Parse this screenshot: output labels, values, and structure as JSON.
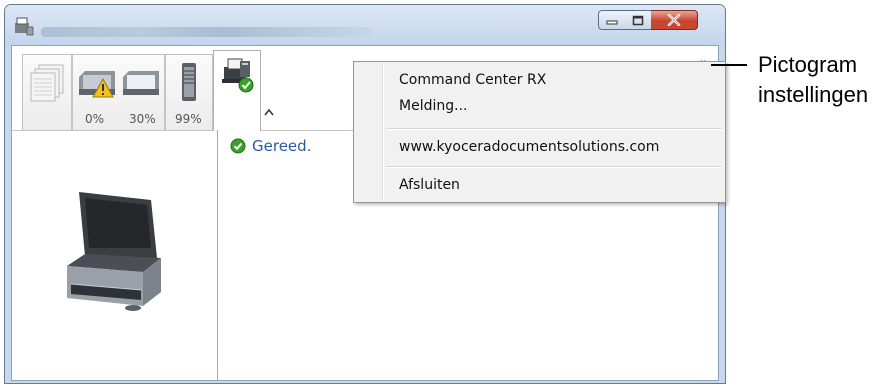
{
  "window": {
    "title_text": "",
    "controls": {
      "minimize": "minimize",
      "maximize": "maximize",
      "close": "close"
    }
  },
  "tabs": [
    {
      "id": "pages",
      "label": "",
      "icon": "pages-stack-icon"
    },
    {
      "id": "tray1",
      "label": "0%",
      "icon": "paper-tray-warning-icon"
    },
    {
      "id": "tray2",
      "label": "30%",
      "icon": "paper-tray-icon"
    },
    {
      "id": "toner",
      "label": "99%",
      "icon": "toner-cartridge-icon"
    },
    {
      "id": "status",
      "label": "",
      "icon": "printer-ok-icon",
      "active": true
    }
  ],
  "status": {
    "text": "Gereed.",
    "icon": "check-circle-icon",
    "color": "#2a5aa6"
  },
  "context_menu": {
    "items": [
      {
        "label": "Command Center RX"
      },
      {
        "label": "Melding..."
      },
      {
        "label": "www.kyoceradocumentsolutions.com"
      },
      {
        "label": "Afsluiten"
      }
    ]
  },
  "callout": {
    "line1": "Pictogram",
    "line2": "instellingen"
  },
  "colors": {
    "accent": "#2a5aa6",
    "ok_green": "#3aa12a",
    "warning_yellow": "#f2c21b",
    "close_red": "#c7452f"
  }
}
